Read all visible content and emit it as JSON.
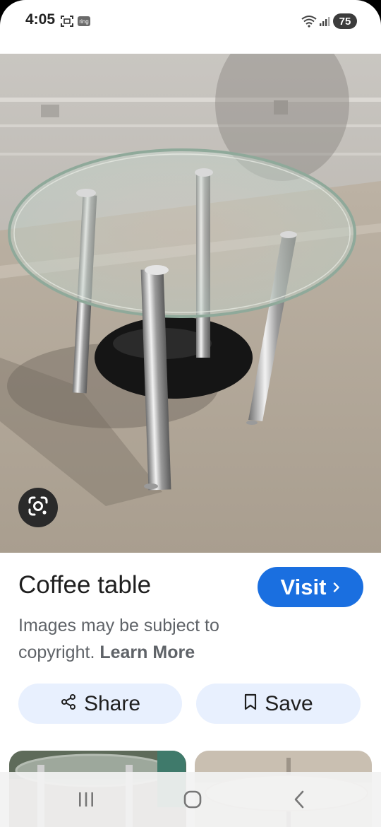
{
  "status_bar": {
    "time": "4:05",
    "ring_badge": "ring",
    "battery_level": "75"
  },
  "result": {
    "title": "Coffee table",
    "visit_label": "Visit",
    "copyright_text": "Images may be subject to copyright.",
    "learn_more": "Learn More"
  },
  "actions": {
    "share_label": "Share",
    "save_label": "Save"
  },
  "icons": {
    "lens": "google-lens-icon",
    "share": "share-icon",
    "save": "bookmark-icon",
    "chevron": "chevron-right-icon",
    "nav_recents": "recents-icon",
    "nav_home": "home-icon",
    "nav_back": "back-icon"
  },
  "colors": {
    "accent": "#1a6fe0",
    "pill_bg": "#e8f0fe",
    "text_secondary": "#5f6368"
  }
}
